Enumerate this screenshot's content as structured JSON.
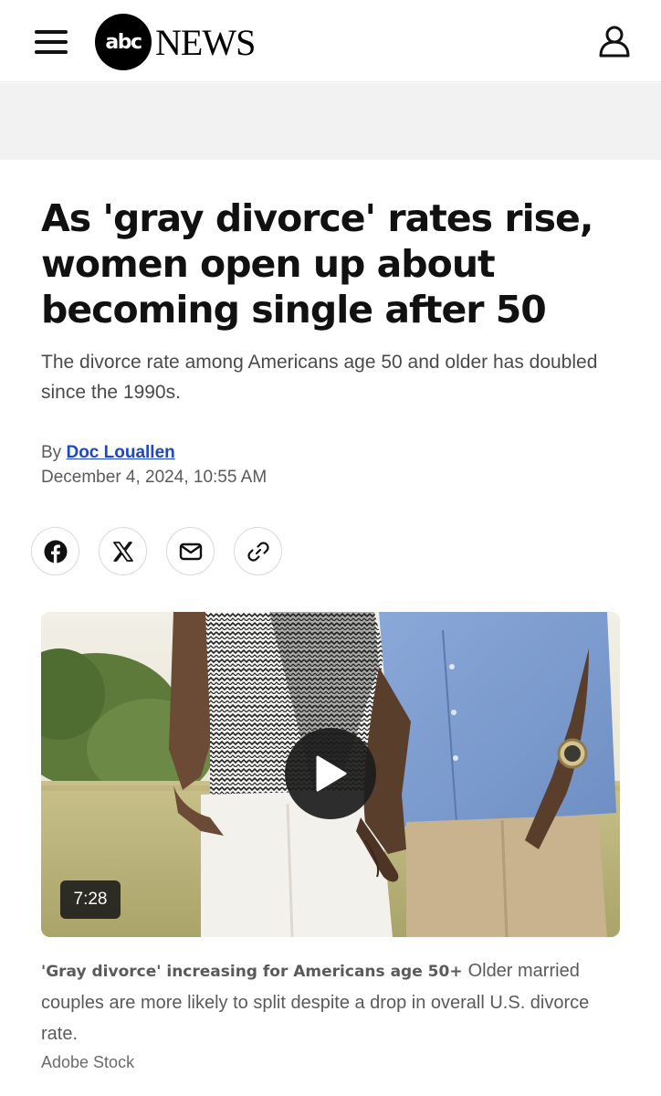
{
  "header": {
    "logo_abc": "abc",
    "logo_news": "NEWS",
    "menu_icon": "hamburger-menu-icon",
    "profile_icon": "user-profile-icon"
  },
  "article": {
    "headline": "As 'gray divorce' rates rise, women open up about becoming single after 50",
    "subheadline": "The divorce rate among Americans age 50 and older has doubled since the 1990s.",
    "byline_prefix": "By",
    "author": "Doc Louallen",
    "date": "December 4, 2024, 10:55 AM"
  },
  "share": [
    {
      "name": "facebook",
      "icon": "facebook-icon"
    },
    {
      "name": "x",
      "icon": "x-icon"
    },
    {
      "name": "email",
      "icon": "mail-icon"
    },
    {
      "name": "copy-link",
      "icon": "link-icon"
    }
  ],
  "video": {
    "duration": "7:28",
    "play_icon": "play-icon",
    "caption_title": "'Gray divorce' increasing for Americans age 50+",
    "caption_text": "Older married couples are more likely to split despite a drop in overall U.S. divorce rate.",
    "credit": "Adobe Stock"
  },
  "colors": {
    "link": "#1b48c4",
    "text": "#1a1a1a",
    "muted": "#5a5a5a",
    "band": "#f2f2f2"
  }
}
